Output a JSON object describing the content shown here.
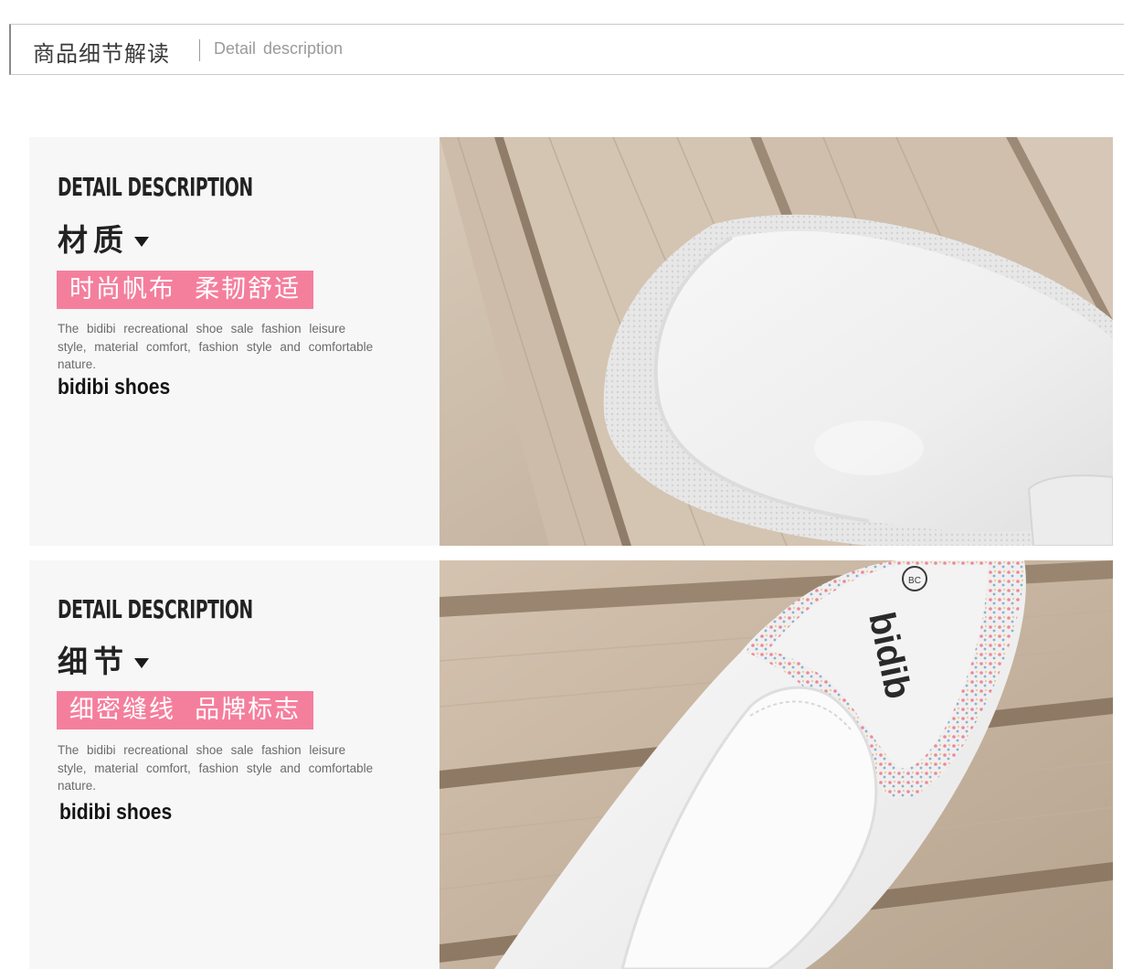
{
  "header": {
    "title": "商品细节解读",
    "subtitle": "Detail  description"
  },
  "sections": [
    {
      "kicker": "DETAIL DESCRIPTION",
      "topic": "材质",
      "tag": "时尚帆布  柔韧舒适",
      "description": "The  bidibi  recreational  shoe  sale  fashion  leisure style,  material  comfort,  fashion  style  and comfortable  nature.",
      "brand": "bidibi shoes",
      "photo_icon": "shoe-toe-photo"
    },
    {
      "kicker": "DETAIL DESCRIPTION",
      "topic": "细节",
      "tag": "细密缝线  品牌标志",
      "description": "The  bidibi  recreational  shoe  sale  fashion  leisure style,  material  comfort,  fashion  style  and comfortable  nature.",
      "brand": "bidibi shoes",
      "photo_icon": "shoe-insole-photo",
      "insole_logo": "bidib",
      "insole_badge": "BC"
    }
  ],
  "colors": {
    "tag_pink": "#f47f9d",
    "panel_bg": "#f7f7f7",
    "wood": "#c9b8a6",
    "shoe_white": "#f4f4f4"
  }
}
